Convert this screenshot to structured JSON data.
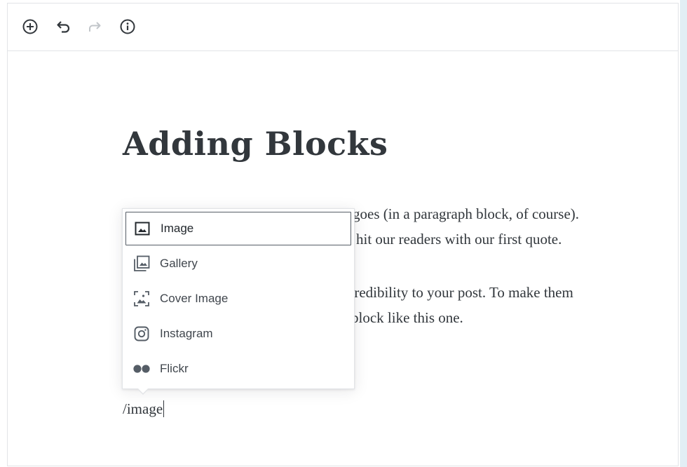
{
  "toolbar": {
    "buttons": [
      {
        "name": "add-block",
        "icon": "plus-circle-icon"
      },
      {
        "name": "undo",
        "icon": "undo-icon"
      },
      {
        "name": "redo",
        "icon": "redo-icon",
        "disabled": true
      },
      {
        "name": "info",
        "icon": "info-icon"
      }
    ]
  },
  "editor": {
    "title": "Adding Blocks",
    "paragraph_1": {
      "line_1": "goes (in a paragraph block, of course).",
      "line_2": "hit our readers with our first quote."
    },
    "paragraph_2": {
      "line_1": "credibility to your post. To make them",
      "line_2": "block like this one."
    },
    "slash_command": "/image"
  },
  "inserter": {
    "items": [
      {
        "label": "Image",
        "icon": "image-icon",
        "selected": true
      },
      {
        "label": "Gallery",
        "icon": "gallery-icon"
      },
      {
        "label": "Cover Image",
        "icon": "cover-image-icon"
      },
      {
        "label": "Instagram",
        "icon": "instagram-icon"
      },
      {
        "label": "Flickr",
        "icon": "flickr-icon"
      }
    ]
  },
  "colors": {
    "text": "#32373c",
    "icon": "#555d66",
    "border": "#e2e4e7",
    "side_strip": "#e2eef5"
  }
}
